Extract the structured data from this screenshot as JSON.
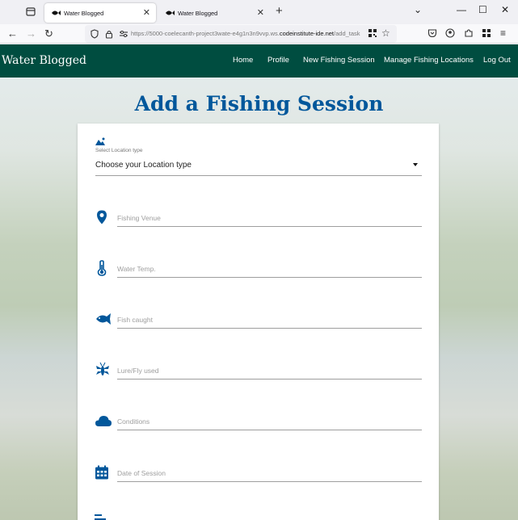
{
  "browser": {
    "tabs": [
      {
        "title": "Water Blogged",
        "active": true
      },
      {
        "title": "Water Blogged",
        "active": false
      }
    ],
    "url_prefix": "https://5000-coelecanth-project3wate-e4g1n3n9vvp.ws.",
    "url_domain": "codeinstitute-ide.net",
    "url_path": "/add_task"
  },
  "header": {
    "brand": "Water Blogged",
    "nav": [
      "Home",
      "Profile",
      "New Fishing Session",
      "Manage Fishing Locations",
      "Log Out"
    ]
  },
  "page": {
    "title": "Add a Fishing Session",
    "location_select": {
      "label": "Select Location type",
      "value": "Choose your Location type",
      "icon": "landscape-icon"
    },
    "fields": [
      {
        "placeholder": "Fishing Venue",
        "icon": "location-pin-icon"
      },
      {
        "placeholder": "Water Temp.",
        "icon": "thermometer-icon"
      },
      {
        "placeholder": "Fish caught",
        "icon": "fish-icon"
      },
      {
        "placeholder": "Lure/Fly used",
        "icon": "fly-icon"
      },
      {
        "placeholder": "Conditions",
        "icon": "cloud-icon"
      },
      {
        "placeholder": "Date of Session",
        "icon": "calendar-icon"
      }
    ]
  },
  "colors": {
    "header": "#004d40",
    "accent": "#01579b"
  }
}
